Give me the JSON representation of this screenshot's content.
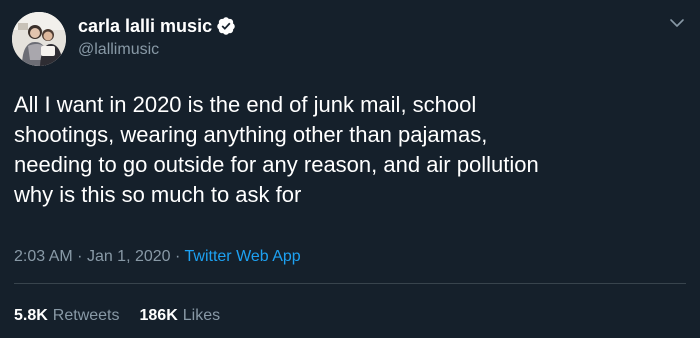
{
  "colors": {
    "background": "#15202b",
    "primary_text": "#ffffff",
    "secondary_text": "#8899a6",
    "link": "#1da1f2",
    "divider": "#38444d"
  },
  "tweet": {
    "author": {
      "display_name": "carla lalli music",
      "handle": "@lallimusic",
      "verified": true,
      "avatar_icon": "profile-photo"
    },
    "text": "All I want in 2020 is the end of junk mail, school\nshootings, wearing anything other than pajamas,\nneeding to go outside for any reason, and air pollution\nwhy is this so much to ask for",
    "time": "2:03 AM",
    "separator_1": "·",
    "date": "Jan 1, 2020",
    "separator_2": "·",
    "source": "Twitter Web App",
    "stats": {
      "retweets_count": "5.8K",
      "retweets_label": "Retweets",
      "likes_count": "186K",
      "likes_label": "Likes"
    },
    "menu_icon": "chevron-down-icon"
  }
}
